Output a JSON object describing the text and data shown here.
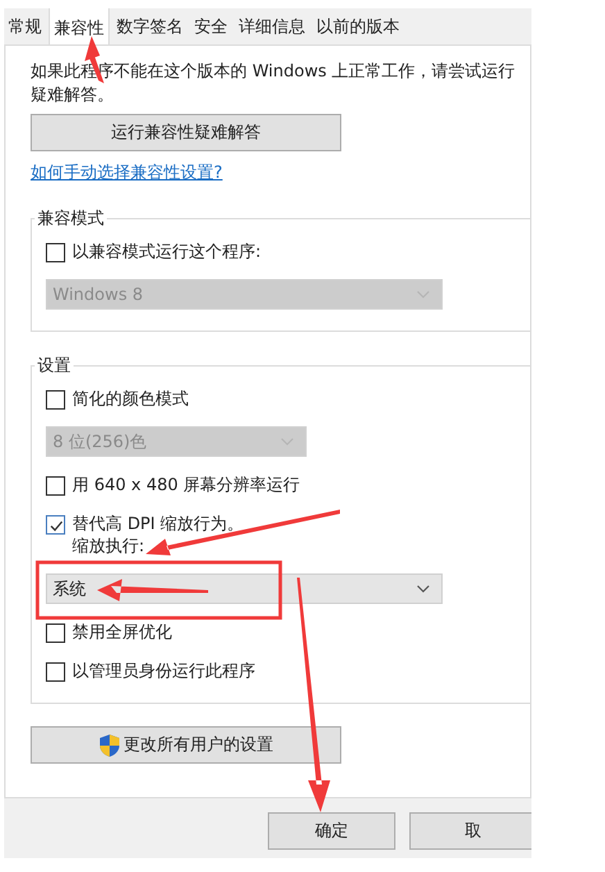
{
  "tabs": [
    {
      "label": "常规",
      "selected": false
    },
    {
      "label": "兼容性",
      "selected": true
    },
    {
      "label": "数字签名",
      "selected": false
    },
    {
      "label": "安全",
      "selected": false
    },
    {
      "label": "详细信息",
      "selected": false
    },
    {
      "label": "以前的版本",
      "selected": false
    }
  ],
  "intro": [
    "如果此程序不能在这个版本的 Windows 上正常工作，请尝试运行",
    "疑难解答。"
  ],
  "troubleshoot_button": "运行兼容性疑难解答",
  "help_link": "如何手动选择兼容性设置?",
  "groups": [
    {
      "title": "兼容模式",
      "items": [
        {
          "kind": "checkbox",
          "label": "以兼容模式运行这个程序:",
          "checked": false
        },
        {
          "kind": "dropdown",
          "value": "Windows 8",
          "disabled": true,
          "wide": true
        }
      ]
    },
    {
      "title": "设置",
      "items": [
        {
          "kind": "checkbox",
          "label": "简化的颜色模式",
          "checked": false
        },
        {
          "kind": "dropdown",
          "value": "8 位(256)色",
          "disabled": true,
          "wide": false
        },
        {
          "kind": "checkbox",
          "label": "用 640 x 480 屏幕分辨率运行",
          "checked": false
        },
        {
          "kind": "checkbox",
          "label": "替代高 DPI 缩放行为。",
          "sublabel": "缩放执行:",
          "checked": true
        },
        {
          "kind": "dropdown",
          "value": "系统",
          "disabled": false,
          "wide": true
        },
        {
          "kind": "checkbox",
          "label": "禁用全屏优化",
          "checked": false
        },
        {
          "kind": "checkbox",
          "label": "以管理员身份运行此程序",
          "checked": false
        }
      ]
    }
  ],
  "all_users_button": "更改所有用户的设置",
  "footer_buttons": [
    "确定",
    "取"
  ]
}
